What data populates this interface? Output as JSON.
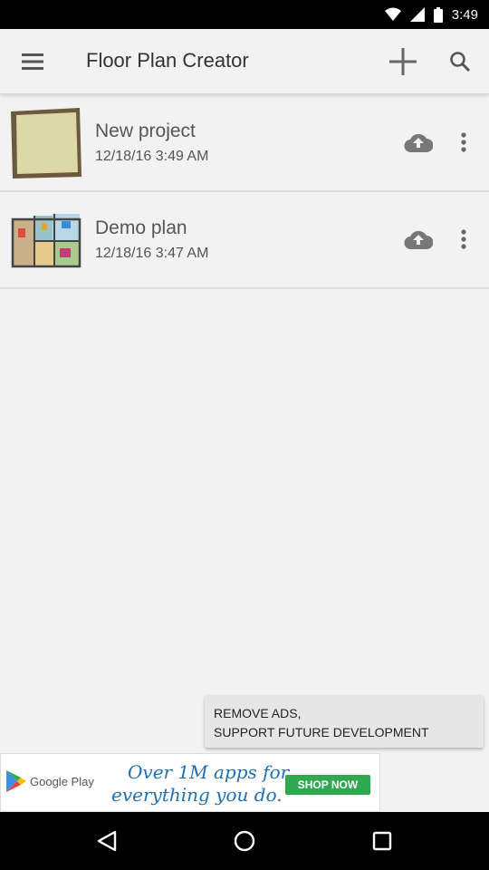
{
  "status_bar": {
    "time": "3:49"
  },
  "app_bar": {
    "title": "Floor Plan Creator"
  },
  "projects": [
    {
      "title": "New project",
      "date": "12/18/16 3:49 AM"
    },
    {
      "title": "Demo plan",
      "date": "12/18/16 3:47 AM"
    }
  ],
  "remove_ads": {
    "line1": "REMOVE ADS,",
    "line2": "SUPPORT FUTURE DEVELOPMENT"
  },
  "ad": {
    "brand": "Google Play",
    "line1": "Over 1M apps for",
    "line2": "everything you do.",
    "cta": "SHOP NOW"
  },
  "colors": {
    "accent_ad": "#2fa84f",
    "ad_text": "#1e6fb3",
    "icon_grey": "#757575"
  }
}
